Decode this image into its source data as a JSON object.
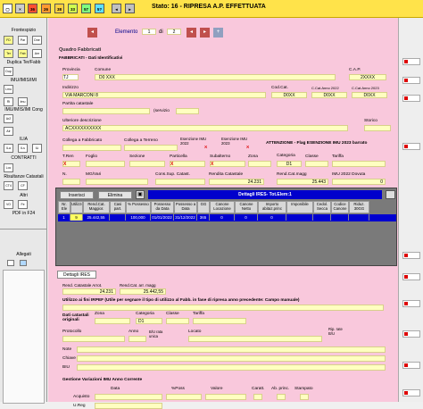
{
  "colors": {
    "topbar": "#ffe34a",
    "main_bg": "#f9c8dc",
    "field_bg": "#ffffc0",
    "grid_header": "#0000cc",
    "nav_arrow": "#c0504d"
  },
  "topbar": {
    "numbers": [
      "36",
      "26",
      "38",
      "33",
      "57",
      "5?"
    ],
    "status": "Stato: 16 - RIPRESA A.P. EFFETTUATA"
  },
  "sidebar": {
    "frontespizio": "Frontespizio",
    "duplica": "Duplica Ter/Fabb",
    "imu_ims": "IMU/IMIS/IMI",
    "imu_cong": "IMU/IMIS/IMI Cong",
    "ilia": "ILIA",
    "contratti": "CONTRATTI",
    "risultanze": "Risultanze Catastali",
    "altri": "Altri",
    "pdf": "PDF in F24",
    "allegati": "Allegati",
    "btn_codes": [
      "FD",
      "Par",
      "Dne",
      "Ter",
      "Fab",
      "Anr",
      "Dup",
      "Lmu",
      "Ri",
      "Imu",
      "Ar2",
      "AIr",
      "ILa",
      "ILs",
      "ILi",
      "Loc",
      "CT4",
      "CF",
      "VO",
      "Fe"
    ]
  },
  "nav": {
    "elemento_label": "Elemento",
    "elemento_value": "1",
    "di_label": "di",
    "di_value": "2"
  },
  "quadro": {
    "title": "Quadro Fabbricati",
    "section1": "FABBRICATI - Dati Identificativi",
    "provincia_label": "Provincia",
    "provincia_value": "TJ",
    "comune_label": "Comune",
    "comune_value": "D0 XXX",
    "cap_label": "C.A.P.",
    "cap_value": "2XXXX",
    "indirizzo_label": "Indirizzo",
    "indirizzo_value": "VIA MARCONI 8",
    "codcat_label": "Cod.Cat.",
    "codcat_value": "D0XX",
    "ccat2022_label": "C.Cat.Anno 2022",
    "ccat2022_value": "D0XX",
    "ccat2023_label": "C.Cat.Anno 2023",
    "ccat2023_value": "D0XX",
    "partita_label": "Partita catastale",
    "servizio_label": "(servizio",
    "storico_label": "Storico",
    "ulteriore_label": "Ulteriore descrizione",
    "ulteriore_value": "ACXXXXXXXXXX",
    "collegafab_label": "Collega a Fabbricato",
    "collegater_label": "Collega a Terreno",
    "esen2022_label": "Esenzione IMU 2022",
    "esen2023_label": "Esenzione IMU 2023",
    "esen_x": "X",
    "attenzione": "ATTENZIONE - Flag ESENZIONE IMU 2023 barrato",
    "tren_label": "T.Ren",
    "foglio_label": "Foglio",
    "sezione_label": "Sezione",
    "particella_label": "Particella",
    "subalterno_label": "Subalterno",
    "zona_label": "Zona",
    "categoria_label": "Categoria",
    "classe_label": "Classe",
    "tariffa_label": "Tariffa",
    "tren_value": "X",
    "particella_value": "X",
    "subalterno_value": "X",
    "categoria_value": "D1",
    "nmgvari_label": "N.",
    "mgvari_label": "MG/Vari",
    "conssup_label": "Cons.Sup. Catast.",
    "rendita_label": "Rendita Catastale",
    "rendita_value": "24.231",
    "rendmagg_label": "Rend.Cat.magg",
    "rendmagg_value": "25.443",
    "imudovuta_label": "IMU 2022 Dovuta",
    "imudovuta_value": "0"
  },
  "grid": {
    "inserisci": "Inserisci",
    "elimina": "Elimina",
    "title": "Dettagli IRES- Tot.Elem:1",
    "headers": [
      "Nr. Ele",
      "Utilizzo",
      "Rend.Cat. Maggior.",
      "Casi part.",
      "% Possesso",
      "Possesso da Data",
      "Possesso a Data",
      "GG",
      "Canone Locazione",
      "Canone Netto",
      "Importo abitaz.princ",
      "Imponibile",
      "Cedol. Secca",
      "Codice Canone",
      "Riduz. 30GG"
    ],
    "row": [
      "1",
      "9",
      "25.442,55",
      "",
      "100,000",
      "01/01/2022",
      "31/12/2022",
      "365",
      "0",
      "0",
      "0",
      "",
      "",
      "",
      ""
    ]
  },
  "dettagli": {
    "tab": "Dettagli IRES",
    "rend_arrot_label": "Rend. Catastale Arrot.",
    "rend_arrot_value": "24.231",
    "rend_magg_label": "Rend.Cat. arr. magg",
    "rend_magg_value": "25.442,55",
    "utilizzo_note": "Utilizzo ai fini IRPEF (Utile per segnare il tipo di utilizzo al Fabb. in fase di ripresa anno precedente: Campo manuale)",
    "dati_originali": "Dati catastali originali",
    "zona": "Zona",
    "categoria": "Categoria",
    "classe": "Classe",
    "tariffa": "Tariffa",
    "categoria_value": "D1",
    "protocollo": "Protocollo",
    "anno": "Anno",
    "biu_rata": "B/U rata unica",
    "locato": "Locato",
    "rip_rate": "Rip. rate B/U",
    "note": "Note",
    "chiave": "Chiave",
    "biu": "BIU",
    "gestione": "Gestione Variazioni IMU Anno Corrente",
    "data": "Data",
    "poss": "%Poss",
    "valore": "Valore",
    "caratt": "Caratt.",
    "abpr": "Ab. princ.",
    "stampato": "Stampato",
    "acquisto": "Acquisto",
    "ureg": "U.Reg"
  }
}
